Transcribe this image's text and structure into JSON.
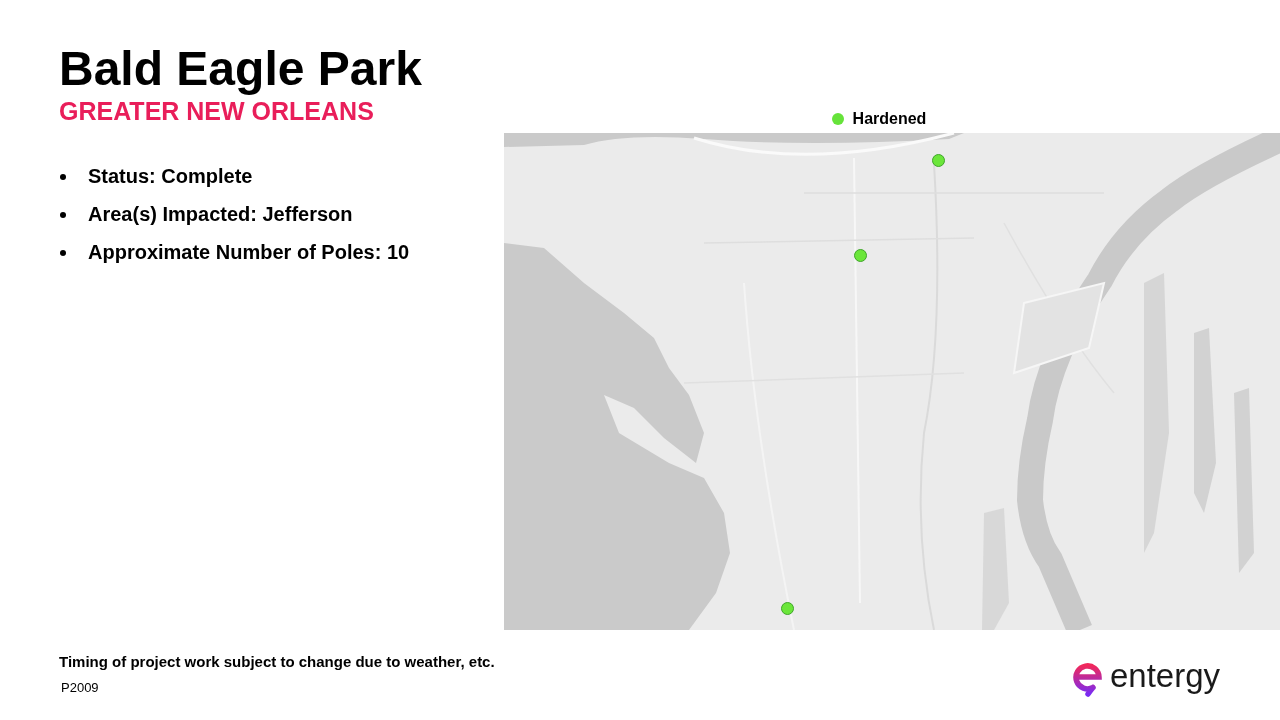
{
  "title": "Bald Eagle Park",
  "subtitle": "GREATER NEW ORLEANS",
  "details": [
    "Status: Complete",
    "Area(s) Impacted: Jefferson",
    "Approximate Number of Poles: 10"
  ],
  "map": {
    "legend": [
      {
        "label": "Hardened"
      }
    ]
  },
  "footer": {
    "note": "Timing of project work subject to change due to weather, etc.",
    "page_code": "P2009"
  },
  "logo": {
    "wordmark": "entergy"
  }
}
